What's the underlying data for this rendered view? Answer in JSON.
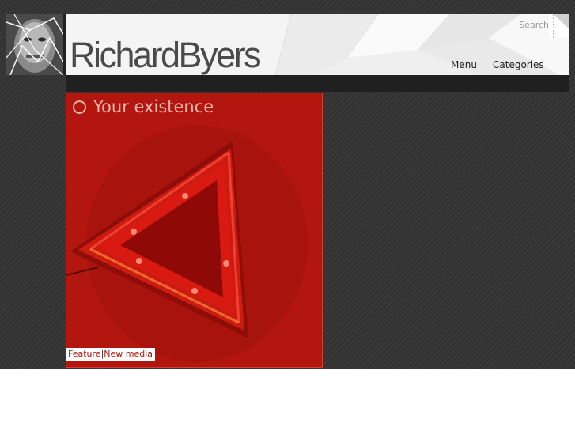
{
  "site": {
    "name": "RichardByers"
  },
  "header": {
    "search_placeholder": "Search",
    "nav": {
      "menu": "Menu",
      "categories": "Categories"
    }
  },
  "post": {
    "title": "Your existence",
    "tags": [
      "Feature",
      "New media"
    ],
    "tag_separator": "|"
  },
  "colors": {
    "page_background": "#353535",
    "card_red": "#b3150f",
    "header_background": "#f4f4f4",
    "strip": "#202020"
  }
}
